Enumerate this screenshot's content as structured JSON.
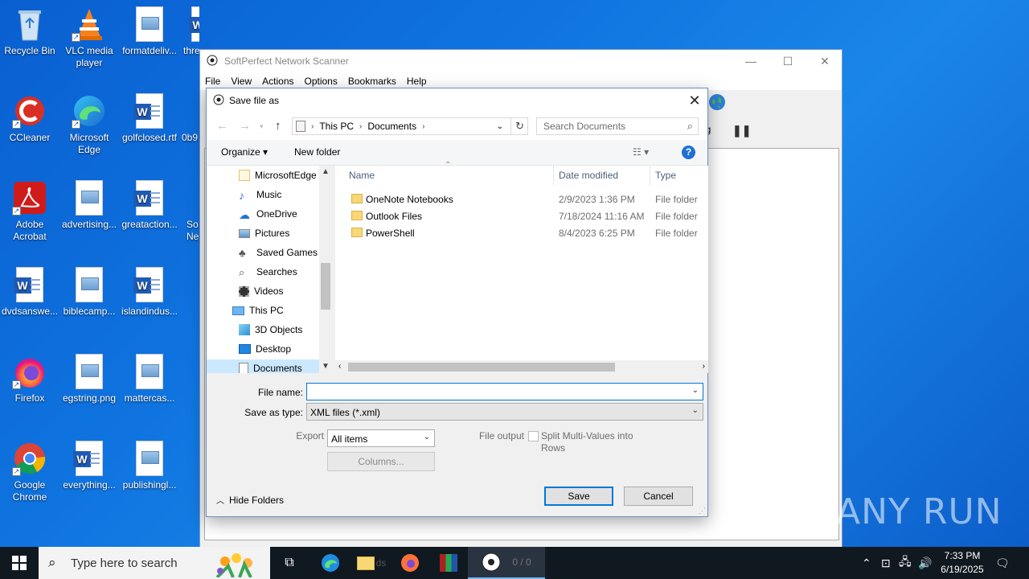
{
  "desktop": {
    "icons": [
      {
        "label": "Recycle Bin"
      },
      {
        "label": "VLC media player"
      },
      {
        "label": "formatdeliv..."
      },
      {
        "label": "thre"
      },
      {
        "label": "CCleaner"
      },
      {
        "label": "Microsoft Edge"
      },
      {
        "label": "golfclosed.rtf"
      },
      {
        "label": "0b9"
      },
      {
        "label": "Adobe Acrobat"
      },
      {
        "label": "advertising..."
      },
      {
        "label": "greataction..."
      },
      {
        "label": "So Ne"
      },
      {
        "label": "dvdsanswe..."
      },
      {
        "label": "biblecamp..."
      },
      {
        "label": "islandindus..."
      },
      {
        "label": "Firefox"
      },
      {
        "label": "egstring.png"
      },
      {
        "label": "mattercas..."
      },
      {
        "label": "Google Chrome"
      },
      {
        "label": "everything..."
      },
      {
        "label": "publishingl..."
      }
    ]
  },
  "app": {
    "title": "SoftPerfect Network Scanner",
    "menu": [
      "File",
      "View",
      "Actions",
      "Options",
      "Bookmarks",
      "Help"
    ],
    "partial_text": "ng"
  },
  "dialog": {
    "title": "Save file as",
    "breadcrumb": [
      "This PC",
      "Documents"
    ],
    "search_placeholder": "Search Documents",
    "organize_label": "Organize",
    "new_folder_label": "New folder",
    "nav_items": [
      {
        "label": "MicrosoftEdge",
        "icon": "folder-icon"
      },
      {
        "label": "Music",
        "icon": "music-icon"
      },
      {
        "label": "OneDrive",
        "icon": "cloud-icon"
      },
      {
        "label": "Pictures",
        "icon": "pictures-icon"
      },
      {
        "label": "Saved Games",
        "icon": "saved-games-icon"
      },
      {
        "label": "Searches",
        "icon": "search-icon"
      },
      {
        "label": "Videos",
        "icon": "videos-icon"
      },
      {
        "label": "This PC",
        "icon": "computer-icon"
      },
      {
        "label": "3D Objects",
        "icon": "cube-icon"
      },
      {
        "label": "Desktop",
        "icon": "desktop-icon"
      },
      {
        "label": "Documents",
        "icon": "documents-icon"
      }
    ],
    "columns": [
      "Name",
      "Date modified",
      "Type"
    ],
    "files": [
      {
        "name": "OneNote Notebooks",
        "date": "2/9/2023 1:36 PM",
        "type": "File folder"
      },
      {
        "name": "Outlook Files",
        "date": "7/18/2024 11:16 AM",
        "type": "File folder"
      },
      {
        "name": "PowerShell",
        "date": "8/4/2023 6:25 PM",
        "type": "File folder"
      }
    ],
    "file_name_label": "File name:",
    "file_name_value": "",
    "save_as_type_label": "Save as type:",
    "save_as_type_value": "XML files (*.xml)",
    "export_label": "Export",
    "export_value": "All items",
    "columns_button": "Columns...",
    "file_output_label": "File output",
    "split_label_1": "Split Multi-Values into",
    "split_label_2": "Rows",
    "hide_folders_label": "Hide Folders",
    "save_button": "Save",
    "cancel_button": "Cancel"
  },
  "watermark": "ANY RUN",
  "taskbar": {
    "search_placeholder": "Type here to search",
    "partial_1": "ds",
    "partial_2": "0 / 0",
    "time": "7:33 PM",
    "date": "6/19/2025"
  },
  "colors": {
    "accent": "#0078d7",
    "selection": "#cce8ff",
    "desktop": "#0f74e0",
    "folder": "#f8d775"
  }
}
